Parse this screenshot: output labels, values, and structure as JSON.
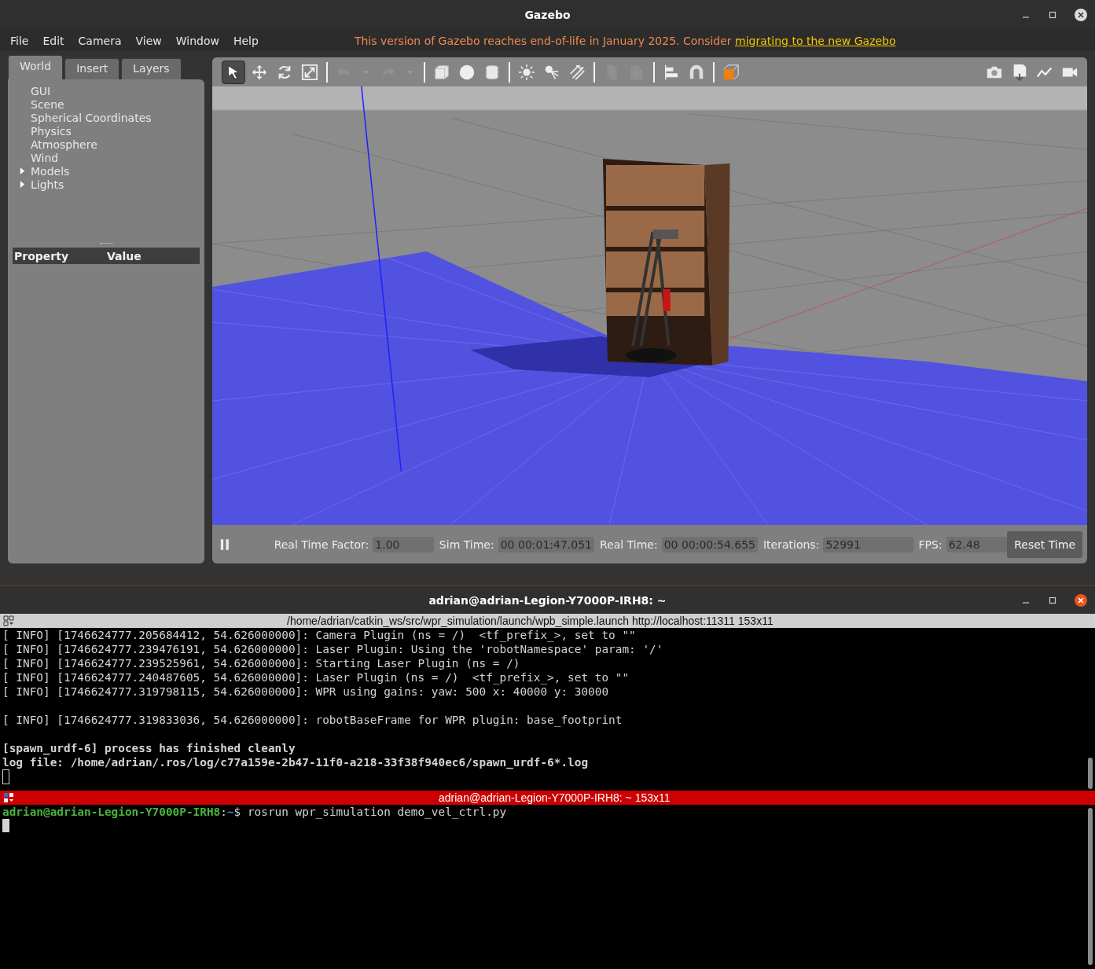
{
  "gazebo": {
    "title": "Gazebo",
    "menu": [
      {
        "label": "File"
      },
      {
        "label": "Edit"
      },
      {
        "label": "Camera"
      },
      {
        "label": "View"
      },
      {
        "label": "Window"
      },
      {
        "label": "Help"
      }
    ],
    "notice": {
      "text": "This version of Gazebo reaches end-of-life in January 2025. Consider ",
      "link": "migrating to the new Gazebo"
    },
    "tabs": [
      {
        "label": "World",
        "selected": true
      },
      {
        "label": "Insert",
        "selected": false
      },
      {
        "label": "Layers",
        "selected": false
      }
    ],
    "tree": [
      {
        "label": "GUI"
      },
      {
        "label": "Scene"
      },
      {
        "label": "Spherical Coordinates"
      },
      {
        "label": "Physics"
      },
      {
        "label": "Atmosphere"
      },
      {
        "label": "Wind"
      },
      {
        "label": "Models",
        "expanded": false
      },
      {
        "label": "Lights",
        "expanded": false
      }
    ],
    "property_header": {
      "property": "Property",
      "value": "Value"
    },
    "tools": [
      {
        "kind": "select",
        "selected": true
      },
      {
        "kind": "translate",
        "selected": false
      },
      {
        "kind": "rotate",
        "selected": false
      },
      {
        "kind": "scale",
        "selected": false
      },
      {
        "kind": "sep"
      },
      {
        "kind": "undo",
        "disabled": true
      },
      {
        "kind": "caret"
      },
      {
        "kind": "redo",
        "disabled": true
      },
      {
        "kind": "caret"
      },
      {
        "kind": "sep"
      },
      {
        "kind": "box"
      },
      {
        "kind": "sphere"
      },
      {
        "kind": "cylinder"
      },
      {
        "kind": "sep"
      },
      {
        "kind": "sun"
      },
      {
        "kind": "spot"
      },
      {
        "kind": "directional"
      },
      {
        "kind": "sep"
      },
      {
        "kind": "copy",
        "disabled": true
      },
      {
        "kind": "paste",
        "disabled": true
      },
      {
        "kind": "sep"
      },
      {
        "kind": "align"
      },
      {
        "kind": "magnet"
      },
      {
        "kind": "sep"
      },
      {
        "kind": "view"
      }
    ],
    "right_tools": [
      {
        "kind": "camera"
      },
      {
        "kind": "log"
      },
      {
        "kind": "plot"
      },
      {
        "kind": "video"
      }
    ],
    "status": {
      "paused": false,
      "fields": [
        {
          "label": "Real Time Factor:",
          "value": "1.00"
        },
        {
          "label": "Sim Time:",
          "value": "00 00:01:47.051"
        },
        {
          "label": "Real Time:",
          "value": "00 00:00:54.655"
        },
        {
          "label": "Iterations:",
          "value": "52991"
        },
        {
          "label": "FPS:",
          "value": "62.48"
        }
      ],
      "reset_button": "Reset Time"
    }
  },
  "terminal": {
    "title": "adrian@adrian-Legion-Y7000P-IRH8: ~",
    "pane1": {
      "title": "/home/adrian/catkin_ws/src/wpr_simulation/launch/wpb_simple.launch http://localhost:11311 153x11",
      "active": false,
      "blocks": [
        [
          {
            "kind": "info",
            "text": "[ INFO] [1746624777.205684412, 54.626000000]: Camera Plugin (ns = /)  <tf_prefix_>, set to \"\""
          },
          {
            "kind": "info",
            "text": "[ INFO] [1746624777.239476191, 54.626000000]: Laser Plugin: Using the 'robotNamespace' param: '/'"
          },
          {
            "kind": "info",
            "text": "[ INFO] [1746624777.239525961, 54.626000000]: Starting Laser Plugin (ns = /)"
          },
          {
            "kind": "info",
            "text": "[ INFO] [1746624777.240487605, 54.626000000]: Laser Plugin (ns = /)  <tf_prefix_>, set to \"\""
          },
          {
            "kind": "info",
            "text": "[ INFO] [1746624777.319798115, 54.626000000]: WPR using gains: yaw: 500 x: 40000 y: 30000"
          }
        ],
        [
          {
            "kind": "info",
            "text": "[ INFO] [1746624777.319833036, 54.626000000]: robotBaseFrame for WPR plugin: base_footprint"
          }
        ],
        [
          {
            "kind": "bold",
            "text": "[spawn_urdf-6] process has finished cleanly"
          },
          {
            "kind": "bold",
            "text": "log file: /home/adrian/.ros/log/c77a159e-2b47-11f0-a218-33f38f940ec6/spawn_urdf-6*.log"
          }
        ]
      ]
    },
    "pane2": {
      "title": "adrian@adrian-Legion-Y7000P-IRH8: ~ 153x11",
      "active": true,
      "prompt": {
        "user_host": "adrian@adrian-Legion-Y7000P-IRH8",
        "sep": ":",
        "path": "~",
        "symbol": "$",
        "command": " rosrun wpr_simulation demo_vel_ctrl.py"
      }
    }
  }
}
